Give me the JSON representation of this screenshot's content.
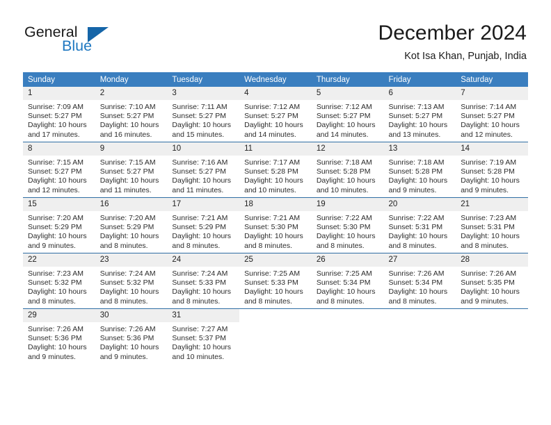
{
  "brand": {
    "word1": "General",
    "word2": "Blue",
    "triangle_color": "#1565a8",
    "blue_color": "#1f78c1"
  },
  "header": {
    "title": "December 2024",
    "subtitle": "Kot Isa Khan, Punjab, India"
  },
  "theme": {
    "header_bg": "#3a7ebf",
    "row_divider": "#2e6da4",
    "daynum_bg": "#efefef"
  },
  "weekday_headers": [
    "Sunday",
    "Monday",
    "Tuesday",
    "Wednesday",
    "Thursday",
    "Friday",
    "Saturday"
  ],
  "days": [
    {
      "day": "1",
      "sunrise": "Sunrise: 7:09 AM",
      "sunset": "Sunset: 5:27 PM",
      "daylight": "Daylight: 10 hours and 17 minutes."
    },
    {
      "day": "2",
      "sunrise": "Sunrise: 7:10 AM",
      "sunset": "Sunset: 5:27 PM",
      "daylight": "Daylight: 10 hours and 16 minutes."
    },
    {
      "day": "3",
      "sunrise": "Sunrise: 7:11 AM",
      "sunset": "Sunset: 5:27 PM",
      "daylight": "Daylight: 10 hours and 15 minutes."
    },
    {
      "day": "4",
      "sunrise": "Sunrise: 7:12 AM",
      "sunset": "Sunset: 5:27 PM",
      "daylight": "Daylight: 10 hours and 14 minutes."
    },
    {
      "day": "5",
      "sunrise": "Sunrise: 7:12 AM",
      "sunset": "Sunset: 5:27 PM",
      "daylight": "Daylight: 10 hours and 14 minutes."
    },
    {
      "day": "6",
      "sunrise": "Sunrise: 7:13 AM",
      "sunset": "Sunset: 5:27 PM",
      "daylight": "Daylight: 10 hours and 13 minutes."
    },
    {
      "day": "7",
      "sunrise": "Sunrise: 7:14 AM",
      "sunset": "Sunset: 5:27 PM",
      "daylight": "Daylight: 10 hours and 12 minutes."
    },
    {
      "day": "8",
      "sunrise": "Sunrise: 7:15 AM",
      "sunset": "Sunset: 5:27 PM",
      "daylight": "Daylight: 10 hours and 12 minutes."
    },
    {
      "day": "9",
      "sunrise": "Sunrise: 7:15 AM",
      "sunset": "Sunset: 5:27 PM",
      "daylight": "Daylight: 10 hours and 11 minutes."
    },
    {
      "day": "10",
      "sunrise": "Sunrise: 7:16 AM",
      "sunset": "Sunset: 5:27 PM",
      "daylight": "Daylight: 10 hours and 11 minutes."
    },
    {
      "day": "11",
      "sunrise": "Sunrise: 7:17 AM",
      "sunset": "Sunset: 5:28 PM",
      "daylight": "Daylight: 10 hours and 10 minutes."
    },
    {
      "day": "12",
      "sunrise": "Sunrise: 7:18 AM",
      "sunset": "Sunset: 5:28 PM",
      "daylight": "Daylight: 10 hours and 10 minutes."
    },
    {
      "day": "13",
      "sunrise": "Sunrise: 7:18 AM",
      "sunset": "Sunset: 5:28 PM",
      "daylight": "Daylight: 10 hours and 9 minutes."
    },
    {
      "day": "14",
      "sunrise": "Sunrise: 7:19 AM",
      "sunset": "Sunset: 5:28 PM",
      "daylight": "Daylight: 10 hours and 9 minutes."
    },
    {
      "day": "15",
      "sunrise": "Sunrise: 7:20 AM",
      "sunset": "Sunset: 5:29 PM",
      "daylight": "Daylight: 10 hours and 9 minutes."
    },
    {
      "day": "16",
      "sunrise": "Sunrise: 7:20 AM",
      "sunset": "Sunset: 5:29 PM",
      "daylight": "Daylight: 10 hours and 8 minutes."
    },
    {
      "day": "17",
      "sunrise": "Sunrise: 7:21 AM",
      "sunset": "Sunset: 5:29 PM",
      "daylight": "Daylight: 10 hours and 8 minutes."
    },
    {
      "day": "18",
      "sunrise": "Sunrise: 7:21 AM",
      "sunset": "Sunset: 5:30 PM",
      "daylight": "Daylight: 10 hours and 8 minutes."
    },
    {
      "day": "19",
      "sunrise": "Sunrise: 7:22 AM",
      "sunset": "Sunset: 5:30 PM",
      "daylight": "Daylight: 10 hours and 8 minutes."
    },
    {
      "day": "20",
      "sunrise": "Sunrise: 7:22 AM",
      "sunset": "Sunset: 5:31 PM",
      "daylight": "Daylight: 10 hours and 8 minutes."
    },
    {
      "day": "21",
      "sunrise": "Sunrise: 7:23 AM",
      "sunset": "Sunset: 5:31 PM",
      "daylight": "Daylight: 10 hours and 8 minutes."
    },
    {
      "day": "22",
      "sunrise": "Sunrise: 7:23 AM",
      "sunset": "Sunset: 5:32 PM",
      "daylight": "Daylight: 10 hours and 8 minutes."
    },
    {
      "day": "23",
      "sunrise": "Sunrise: 7:24 AM",
      "sunset": "Sunset: 5:32 PM",
      "daylight": "Daylight: 10 hours and 8 minutes."
    },
    {
      "day": "24",
      "sunrise": "Sunrise: 7:24 AM",
      "sunset": "Sunset: 5:33 PM",
      "daylight": "Daylight: 10 hours and 8 minutes."
    },
    {
      "day": "25",
      "sunrise": "Sunrise: 7:25 AM",
      "sunset": "Sunset: 5:33 PM",
      "daylight": "Daylight: 10 hours and 8 minutes."
    },
    {
      "day": "26",
      "sunrise": "Sunrise: 7:25 AM",
      "sunset": "Sunset: 5:34 PM",
      "daylight": "Daylight: 10 hours and 8 minutes."
    },
    {
      "day": "27",
      "sunrise": "Sunrise: 7:26 AM",
      "sunset": "Sunset: 5:34 PM",
      "daylight": "Daylight: 10 hours and 8 minutes."
    },
    {
      "day": "28",
      "sunrise": "Sunrise: 7:26 AM",
      "sunset": "Sunset: 5:35 PM",
      "daylight": "Daylight: 10 hours and 9 minutes."
    },
    {
      "day": "29",
      "sunrise": "Sunrise: 7:26 AM",
      "sunset": "Sunset: 5:36 PM",
      "daylight": "Daylight: 10 hours and 9 minutes."
    },
    {
      "day": "30",
      "sunrise": "Sunrise: 7:26 AM",
      "sunset": "Sunset: 5:36 PM",
      "daylight": "Daylight: 10 hours and 9 minutes."
    },
    {
      "day": "31",
      "sunrise": "Sunrise: 7:27 AM",
      "sunset": "Sunset: 5:37 PM",
      "daylight": "Daylight: 10 hours and 10 minutes."
    }
  ],
  "grid": {
    "first_day_column_index": 0,
    "num_weeks": 5,
    "trailing_empty_cells": 4
  }
}
